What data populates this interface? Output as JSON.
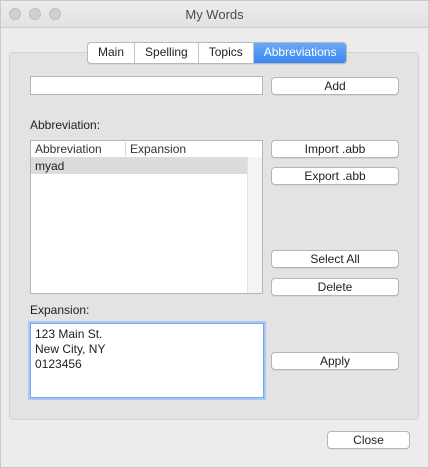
{
  "window": {
    "title": "My Words"
  },
  "tabs": [
    {
      "label": "Main"
    },
    {
      "label": "Spelling"
    },
    {
      "label": "Topics"
    },
    {
      "label": "Abbreviations"
    }
  ],
  "new_abbreviation": {
    "value": "",
    "add_label": "Add"
  },
  "abbreviation_section": {
    "label": "Abbreviation:"
  },
  "table": {
    "columns": [
      "Abbreviation",
      "Expansion"
    ],
    "rows": [
      {
        "abbreviation": "myad",
        "expansion": ""
      }
    ]
  },
  "side_buttons": {
    "import": "Import  .abb",
    "export": "Export  .abb",
    "select_all": "Select All",
    "delete": "Delete",
    "apply": "Apply"
  },
  "expansion_section": {
    "label": "Expansion:",
    "value": "123 Main St.\nNew City, NY\n0123456"
  },
  "footer": {
    "close": "Close"
  }
}
